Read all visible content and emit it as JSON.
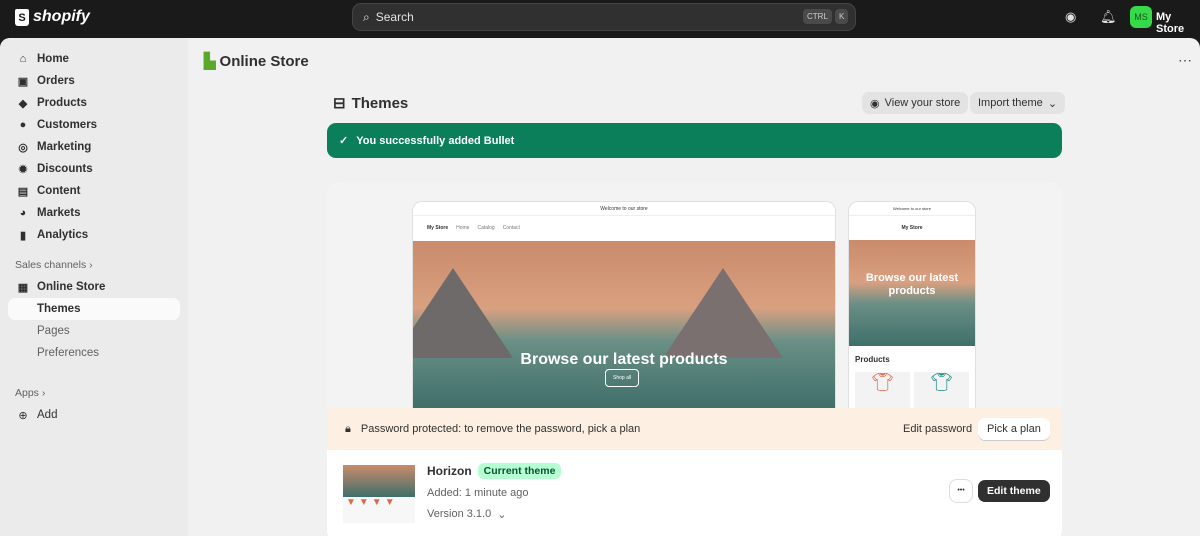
{
  "topbar": {
    "brand": "shopify",
    "search_placeholder": "Search",
    "kbd_ctrl": "CTRL",
    "kbd_k": "K",
    "avatar_initials": "MS",
    "store_name": "My Store"
  },
  "sidebar": {
    "items": [
      {
        "label": "Home"
      },
      {
        "label": "Orders"
      },
      {
        "label": "Products"
      },
      {
        "label": "Customers"
      },
      {
        "label": "Marketing"
      },
      {
        "label": "Discounts"
      },
      {
        "label": "Content"
      },
      {
        "label": "Markets"
      },
      {
        "label": "Analytics"
      }
    ],
    "sales_channels": "Sales channels",
    "online_store": "Online Store",
    "sub": [
      {
        "label": "Themes"
      },
      {
        "label": "Pages"
      },
      {
        "label": "Preferences"
      }
    ],
    "apps": "Apps",
    "add": "Add"
  },
  "main": {
    "title": "Online Store",
    "themes_title": "Themes",
    "view_store": "View your store",
    "import_theme": "Import theme",
    "toast": "You successfully added Bullet",
    "preview": {
      "announcement": "Welcome to our store",
      "store": "My Store",
      "nav": [
        "Home",
        "Catalog",
        "Contact"
      ],
      "hero": "Browse our latest products",
      "shop_all": "Shop all",
      "products": "Products"
    },
    "password_text": "Password protected: to remove the password, pick a plan",
    "edit_password": "Edit password",
    "pick_plan": "Pick a plan",
    "theme": {
      "name": "Horizon",
      "badge": "Current theme",
      "added": "Added: 1 minute ago",
      "version": "Version 3.1.0",
      "more": "•••",
      "edit": "Edit theme"
    }
  },
  "colors": {
    "accent": "#0b7f59",
    "badge": "#b4fed2"
  }
}
